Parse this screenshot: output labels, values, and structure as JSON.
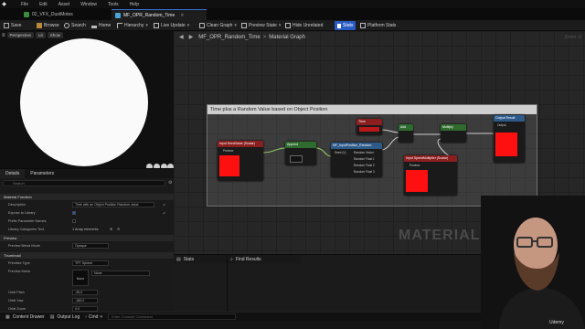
{
  "menubar": {
    "items": [
      "File",
      "Edit",
      "Asset",
      "Window",
      "Tools",
      "Help"
    ]
  },
  "tabs": [
    {
      "label": "02_VFX_DustMotes",
      "active": false
    },
    {
      "label": "MF_OPR_Random_Time",
      "active": true
    }
  ],
  "toolbar": {
    "save": "Save",
    "browse": "Browse",
    "search": "Search",
    "home": "Home",
    "hierarchy": "Hierarchy",
    "live_update": "Live Update",
    "clean_graph": "Clean Graph",
    "preview_state": "Preview State",
    "hide_unrelated": "Hide Unrelated",
    "stats": "Stats",
    "platform_stats": "Platform Stats"
  },
  "viewport": {
    "perspective": "Perspective",
    "lit": "Lit",
    "show": "Show"
  },
  "details": {
    "tabs": [
      "Details",
      "Parameters"
    ],
    "search_placeholder": "Search",
    "sections": {
      "material_function": "Material Function",
      "preview": "Preview",
      "thumbnail": "Thumbnail"
    },
    "rows": {
      "description_label": "Description",
      "description_value": "Time with an Object Position Random value",
      "expose_label": "Expose to Library",
      "prefix_label": "Prefix Parameter Names",
      "library_label": "Library Categories Text",
      "library_value": "1 Array elements",
      "preview_blend_label": "Preview Blend Mode",
      "preview_blend_value": "Opaque",
      "primitive_label": "Primitive Type",
      "primitive_value": "TPT Sphere",
      "preview_mesh_label": "Preview Mesh",
      "preview_mesh_value": "None",
      "preview_mesh_thumb": "None",
      "orbit_pitch_label": "Orbit Pitch",
      "orbit_pitch_value": "-35.0",
      "orbit_yaw_label": "Orbit Yaw",
      "orbit_yaw_value": "-180.0",
      "orbit_zoom_label": "Orbit Zoom",
      "orbit_zoom_value": "0.0"
    }
  },
  "graph": {
    "breadcrumb": "MF_OPR_Random_Time",
    "breadcrumb_sep": ">",
    "breadcrumb_leaf": "Material Graph",
    "zoom": "Zoom -2",
    "comment": "Time plus a Random Value based on Object Position",
    "watermark": "MATERIAL FUNCTION",
    "nodes": {
      "seed_value": {
        "title": "Input SeedValue (Scalar)",
        "pin": "Preview"
      },
      "append": {
        "title": "Append"
      },
      "object_position": {
        "title": "Object Position"
      },
      "random": {
        "title": "MF_InputPosition_Random",
        "pins": [
          "Seed (V)",
          "Random Vector",
          "Random Float 1",
          "Random Float 2",
          "Random Float 3"
        ]
      },
      "time": {
        "title": "Time"
      },
      "add": {
        "title": "Add"
      },
      "multiply": {
        "title": "Multiply"
      },
      "speed": {
        "title": "Input SpeedMultiplier (Scalar)",
        "pin": "Preview"
      },
      "output": {
        "title": "Output Result",
        "pin": "Output"
      }
    }
  },
  "bottom_panels": {
    "stats": "Stats",
    "find_results": "Find Results"
  },
  "statusbar": {
    "content_drawer": "Content Drawer",
    "output_log": "Output Log",
    "cmd": "Cmd",
    "cmd_placeholder": "Enter Console Command"
  },
  "overlay": {
    "udemy": "Udemy"
  },
  "colors": {
    "accent": "#2a5bc4",
    "preview_red": "#ff1010",
    "node_input_header": "#8b1f1f",
    "node_math_header": "#2f6b2f",
    "node_function_header": "#2e5a8a"
  }
}
